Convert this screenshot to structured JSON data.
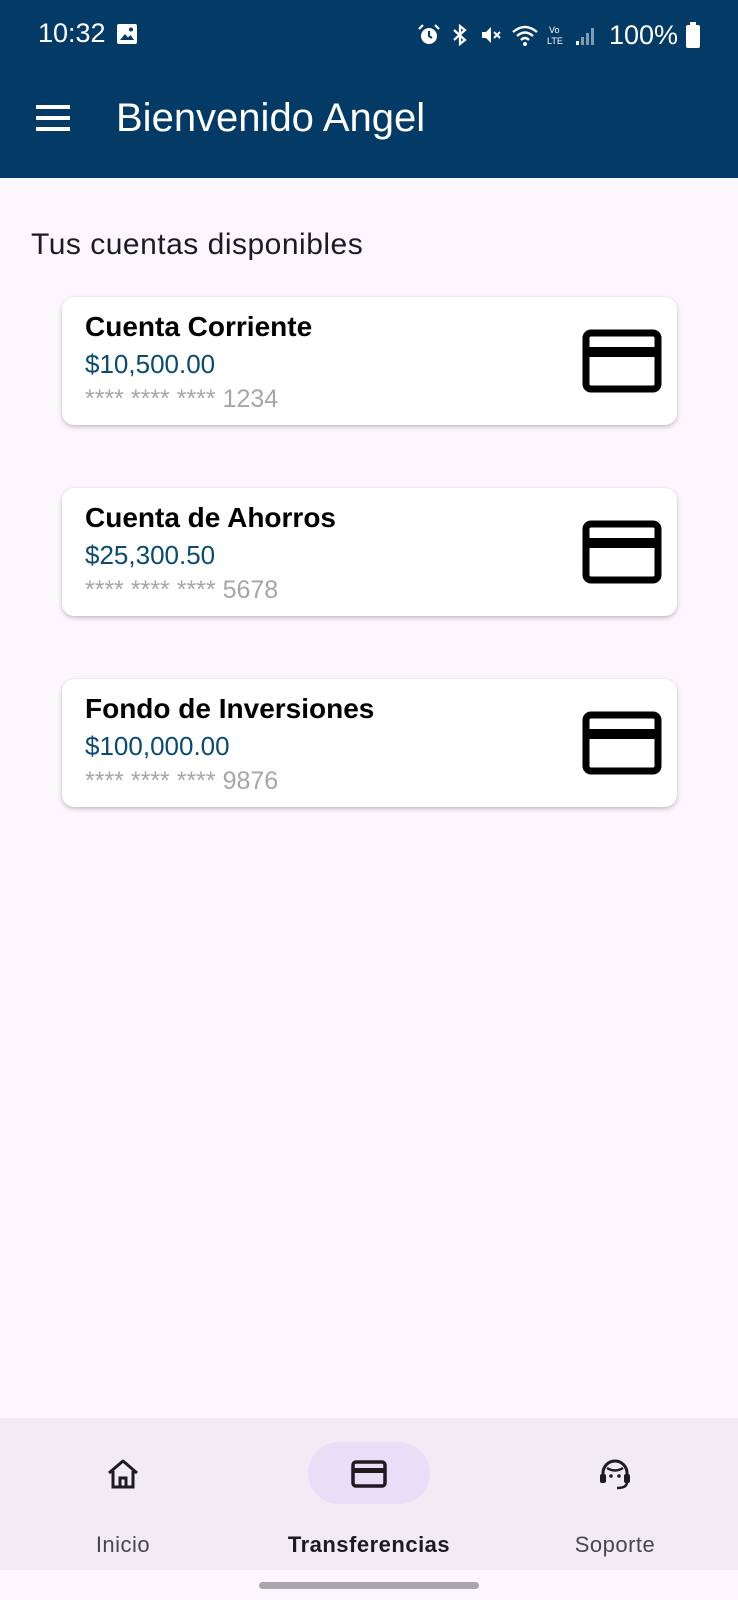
{
  "status_bar": {
    "time": "10:32",
    "battery": "100%"
  },
  "app_bar": {
    "title": "Bienvenido Angel",
    "menu_icon": "menu-icon"
  },
  "section_title": "Tus cuentas disponibles",
  "accounts": [
    {
      "name": "Cuenta Corriente",
      "balance": "$10,500.00",
      "number": "**** **** **** 1234",
      "icon": "credit-card-icon"
    },
    {
      "name": "Cuenta de Ahorros",
      "balance": "$25,300.50",
      "number": "**** **** **** 5678",
      "icon": "credit-card-icon"
    },
    {
      "name": "Fondo de Inversiones",
      "balance": "$100,000.00",
      "number": "**** **** **** 9876",
      "icon": "credit-card-icon"
    }
  ],
  "bottom_nav": {
    "items": [
      {
        "label": "Inicio",
        "icon": "home-icon",
        "active": false
      },
      {
        "label": "Transferencias",
        "icon": "credit-card-icon",
        "active": true
      },
      {
        "label": "Soporte",
        "icon": "support-agent-icon",
        "active": false
      }
    ]
  },
  "colors": {
    "app_bar": "#043a66",
    "background": "#fcf6fd",
    "balance_text": "#0c4a6e",
    "nav_background": "#f1ecf4",
    "nav_active_pill": "#e8def8"
  }
}
